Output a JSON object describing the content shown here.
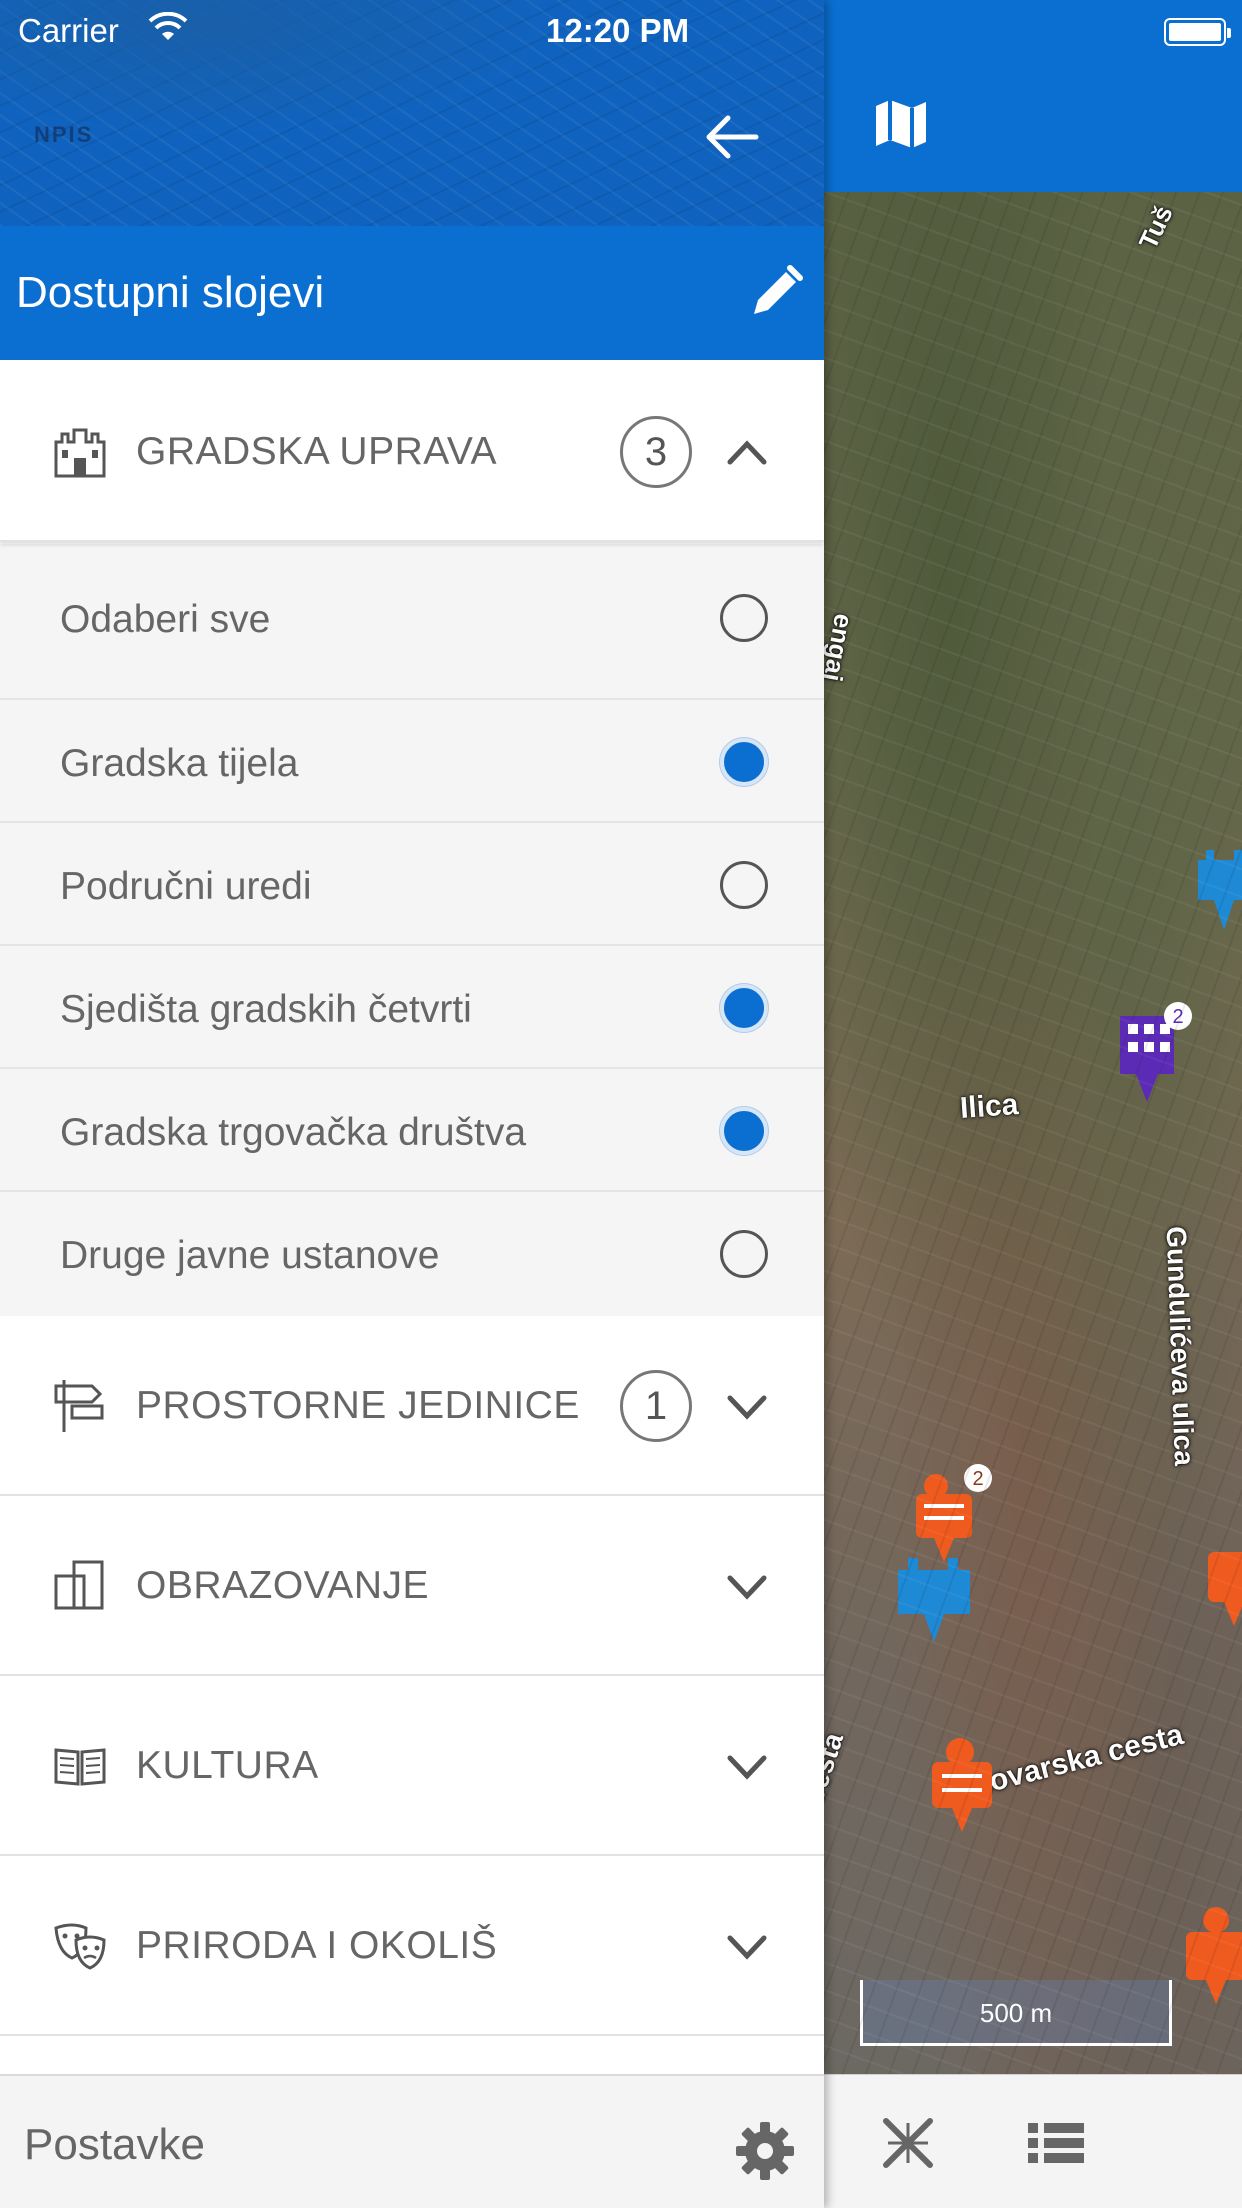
{
  "status_bar": {
    "carrier": "Carrier",
    "time": "12:20 PM"
  },
  "drawer": {
    "header_watermark": "NPIS",
    "title": "Dostupni slojevi",
    "sections": [
      {
        "label": "GRADSKA UPRAVA",
        "count": "3",
        "expanded": true,
        "icon": "castle-icon"
      },
      {
        "label": "PROSTORNE JEDINICE",
        "count": "1",
        "expanded": false,
        "icon": "signpost-icon"
      },
      {
        "label": "OBRAZOVANJE",
        "count": "",
        "expanded": false,
        "icon": "squares-icon"
      },
      {
        "label": "KULTURA",
        "count": "",
        "expanded": false,
        "icon": "book-icon"
      },
      {
        "label": "PRIRODA I OKOLIŠ",
        "count": "",
        "expanded": false,
        "icon": "theater-masks-icon"
      }
    ],
    "sublayers": [
      {
        "label": "Odaberi sve",
        "selected": false
      },
      {
        "label": "Gradska tijela",
        "selected": true
      },
      {
        "label": "Područni uredi",
        "selected": false
      },
      {
        "label": "Sjedišta gradskih četvrti",
        "selected": true
      },
      {
        "label": "Gradska trgovačka društva",
        "selected": true
      },
      {
        "label": "Druge javne ustanove",
        "selected": false
      }
    ],
    "footer_label": "Postavke"
  },
  "map": {
    "streets": [
      "Tuš",
      "Ilica",
      "Gundulićeva ulica",
      "Vukovarska cesta",
      "cesta",
      "engaj"
    ],
    "markers": [
      {
        "type": "company-building-marker",
        "badge": "2",
        "color": "#5b2bb5"
      },
      {
        "type": "restaurant-marker",
        "badge": "2",
        "color": "#ef5a1f"
      },
      {
        "type": "castle-marker",
        "badge": "",
        "color": "#1e8ad6"
      }
    ],
    "scale": "500 m",
    "colors": {
      "accent": "#0a6fd1",
      "radio_on": "#0a6fd1"
    }
  }
}
